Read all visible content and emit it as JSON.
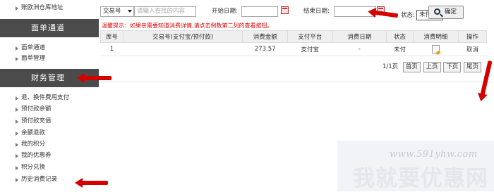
{
  "sidebar": {
    "top_item": "账欧洲仓库地址",
    "sections": [
      {
        "title": "面单通道",
        "items": [
          "面单通道",
          "面单管理"
        ]
      },
      {
        "title": "财务管理",
        "items": [
          "退、换件费用支付",
          "预付款余额",
          "预付款充值",
          "余额退款",
          "我的积分",
          "我的优惠券",
          "积分兑换",
          "历史消费记录"
        ]
      }
    ]
  },
  "filter": {
    "type_select": "交易号",
    "keyword_placeholder": "请输入查找的内容",
    "start_date_label": "开始日期:",
    "end_date_label": "结束日期:",
    "status_label": "状态:",
    "status_value": "未付",
    "confirm_label": "确定"
  },
  "tip": "温馨提示：如果亲需要知道消费详情,请点击倒数第二列的查看按钮。",
  "table": {
    "headers": [
      "库号",
      "交易号(支付宝/预付款)",
      "消费金额",
      "支付平台",
      "消费日期",
      "状态",
      "消费明细",
      "操作"
    ],
    "rows": [
      {
        "id": "1",
        "trade_no": "",
        "amount": "273.57",
        "platform": "支付宝",
        "date": "-",
        "status": "未付",
        "action": "取消"
      }
    ]
  },
  "pager": {
    "info": "1/1页",
    "first": "首页",
    "prev": "上页",
    "next": "下页",
    "last": "尾页"
  },
  "watermark": {
    "url": "www.591yhw.com",
    "text": "我就要优惠网"
  },
  "colors": {
    "sidebar_header_bg": "#4b4b4b",
    "tip_text": "#dd0000",
    "annotation_arrow": "#d40000",
    "table_header_bg": "#efefef"
  }
}
